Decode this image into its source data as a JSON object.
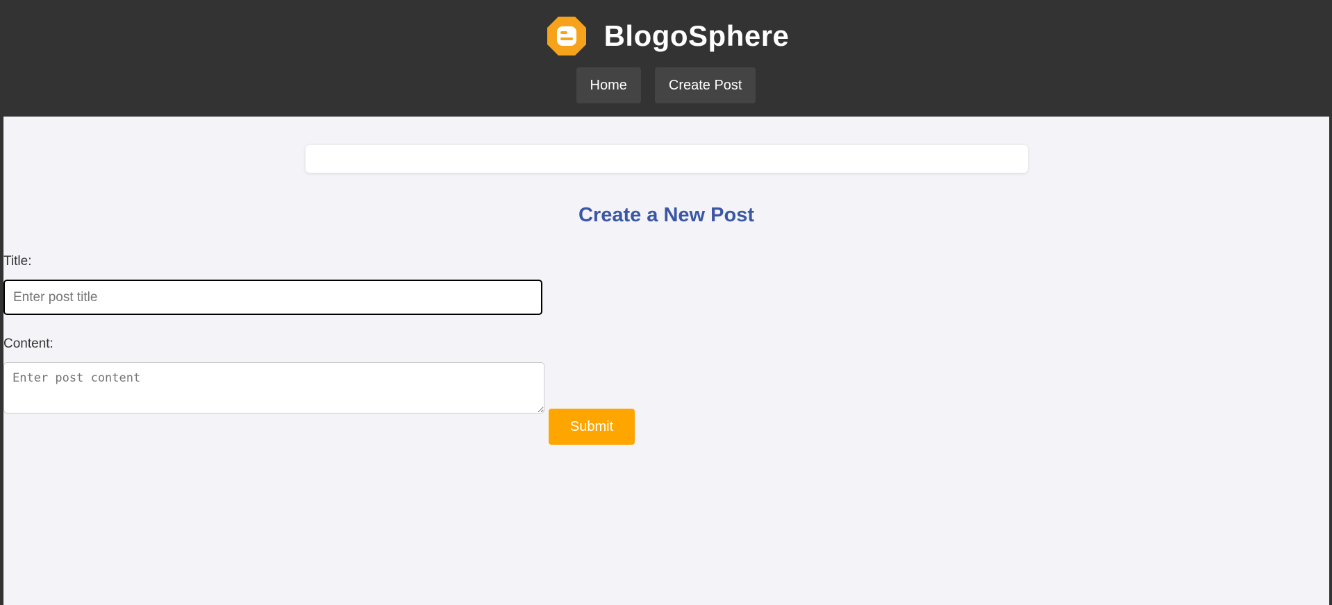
{
  "header": {
    "site_title": "BlogoSphere",
    "logo_icon": "blogger-logo-icon",
    "nav": [
      {
        "label": "Home"
      },
      {
        "label": "Create Post"
      }
    ]
  },
  "main": {
    "message_box": "",
    "form": {
      "heading": "Create a New Post",
      "title_label": "Title:",
      "title_placeholder": "Enter post title",
      "title_value": "",
      "content_label": "Content:",
      "content_placeholder": "Enter post content",
      "content_value": "",
      "submit_label": "Submit"
    }
  },
  "colors": {
    "header_bg": "#333333",
    "nav_button_bg": "#444444",
    "page_bg": "#f4f4f8",
    "heading": "#3a57a6",
    "accent": "#ffa500",
    "logo_orange": "#f7a21b"
  }
}
